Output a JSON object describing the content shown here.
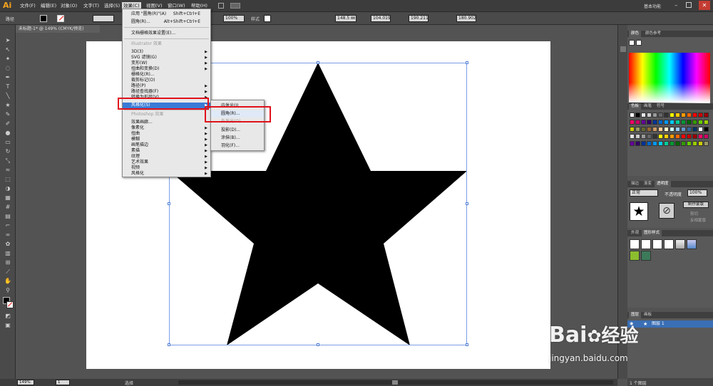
{
  "app": {
    "logo": "Ai",
    "workspace": "基本功能"
  },
  "menubar": {
    "items": [
      "文件(F)",
      "编辑(E)",
      "对象(O)",
      "文字(T)",
      "选择(S)",
      "效果(C)",
      "视图(V)",
      "窗口(W)",
      "帮助(H)"
    ],
    "active": "效果(C)"
  },
  "controlbar": {
    "selection_label": "路径",
    "opacity_value": "100%",
    "style_label": "样式",
    "x_value": "148.5 ㎜",
    "y_value": "104.019",
    "w_value": "190.211",
    "h_value": "180.902"
  },
  "document": {
    "tab_title": "未标题-1* @ 149% (CMYK/预览)"
  },
  "statusbar": {
    "zoom": "149%",
    "page": "1",
    "tool": "选择"
  },
  "effect_menu": {
    "items": [
      {
        "label": "应用 \"圆角(R)\"(A)",
        "shortcut": "Shift+Ctrl+E"
      },
      {
        "label": "圆角(R)...",
        "shortcut": "Alt+Shift+Ctrl+E"
      },
      {
        "label": "文档栅格效果设置(E)...",
        "shortcut": ""
      },
      {
        "label": "Illustrator 效果",
        "header": true
      },
      {
        "label": "3D(3)",
        "sub": true
      },
      {
        "label": "SVG 滤镜(G)",
        "sub": true
      },
      {
        "label": "变形(W)",
        "sub": true
      },
      {
        "label": "扭曲和变换(D)",
        "sub": true
      },
      {
        "label": "栅格化(R)..."
      },
      {
        "label": "裁剪标记(O)"
      },
      {
        "label": "路径(P)",
        "sub": true
      },
      {
        "label": "路径查找器(F)",
        "sub": true
      },
      {
        "label": "转换为形状(V)",
        "sub": true
      },
      {
        "label": "风格化(S)",
        "sub": true,
        "highlighted": true
      },
      {
        "label": "Photoshop 效果",
        "header": true
      },
      {
        "label": "效果画廊..."
      },
      {
        "label": "像素化",
        "sub": true
      },
      {
        "label": "扭曲",
        "sub": true
      },
      {
        "label": "模糊",
        "sub": true
      },
      {
        "label": "画笔描边",
        "sub": true
      },
      {
        "label": "素描",
        "sub": true
      },
      {
        "label": "纹理",
        "sub": true
      },
      {
        "label": "艺术效果",
        "sub": true
      },
      {
        "label": "视频",
        "sub": true
      },
      {
        "label": "风格化",
        "sub": true
      }
    ]
  },
  "stylize_submenu": {
    "items": [
      {
        "label": "内发光(I)..."
      },
      {
        "label": "圆角(R)...",
        "highlighted": true
      },
      {
        "label": "外发光(O)...",
        "dim": true
      },
      {
        "label": "投影(D)..."
      },
      {
        "label": "涂抹(B)..."
      },
      {
        "label": "羽化(F)..."
      }
    ]
  },
  "panels": {
    "color_tabs": [
      "颜色",
      "颜色参考"
    ],
    "swatch_tabs": [
      "色板",
      "画笔",
      "符号"
    ],
    "stroke_tabs": [
      "描边",
      "渐变",
      "透明度"
    ],
    "blend_mode": "正常",
    "opacity_label": "不透明度",
    "opacity_value": "100%",
    "make_mask": "制作蒙版",
    "clip": "剪切",
    "invert_mask": "反相蒙版",
    "appearance_tabs": [
      "外观",
      "图形样式"
    ],
    "layers_tabs": [
      "图层",
      "画板"
    ],
    "layer_name": "图层 1",
    "layers_count": "1 个图层"
  },
  "watermark": {
    "brand": "Bai",
    "brand2": "经验",
    "url": "jingyan.baidu.com"
  }
}
